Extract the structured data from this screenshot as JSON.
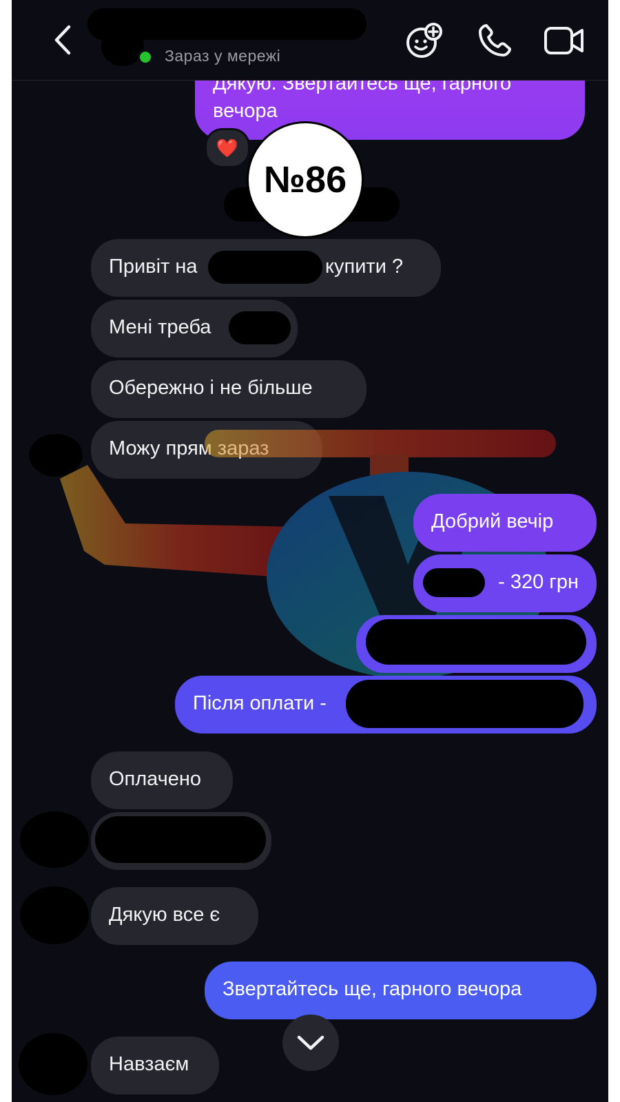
{
  "header": {
    "status": "Зараз у мережі",
    "icons": [
      "back-arrow-icon",
      "sticker-add-icon",
      "phone-icon",
      "video-camera-icon"
    ]
  },
  "overlay": {
    "badge": "№86"
  },
  "messages": {
    "top_outgoing": "Дякую. Звертайтесь ще, гарного вечора",
    "reaction": "❤️",
    "in1": "Привіт на",
    "in1_end": "купити ?",
    "in2": "Мені треба",
    "in3": "Обережно і не більше",
    "in4": "Можу прям зараз",
    "out1": "Добрий вечір",
    "out2": "- 320 грн",
    "out4": "Після оплати -",
    "in5": "Оплачено",
    "in6": "Дякую все є",
    "out5": "Звертайтесь ще, гарного вечора",
    "in7": "Навзаєм"
  },
  "colors": {
    "background": "#0b0c14",
    "incoming_bubble": "#26272e",
    "outgoing_purple": "#8d3bf0",
    "outgoing_blue": "#4a5cf2",
    "online": "#22c32b"
  }
}
